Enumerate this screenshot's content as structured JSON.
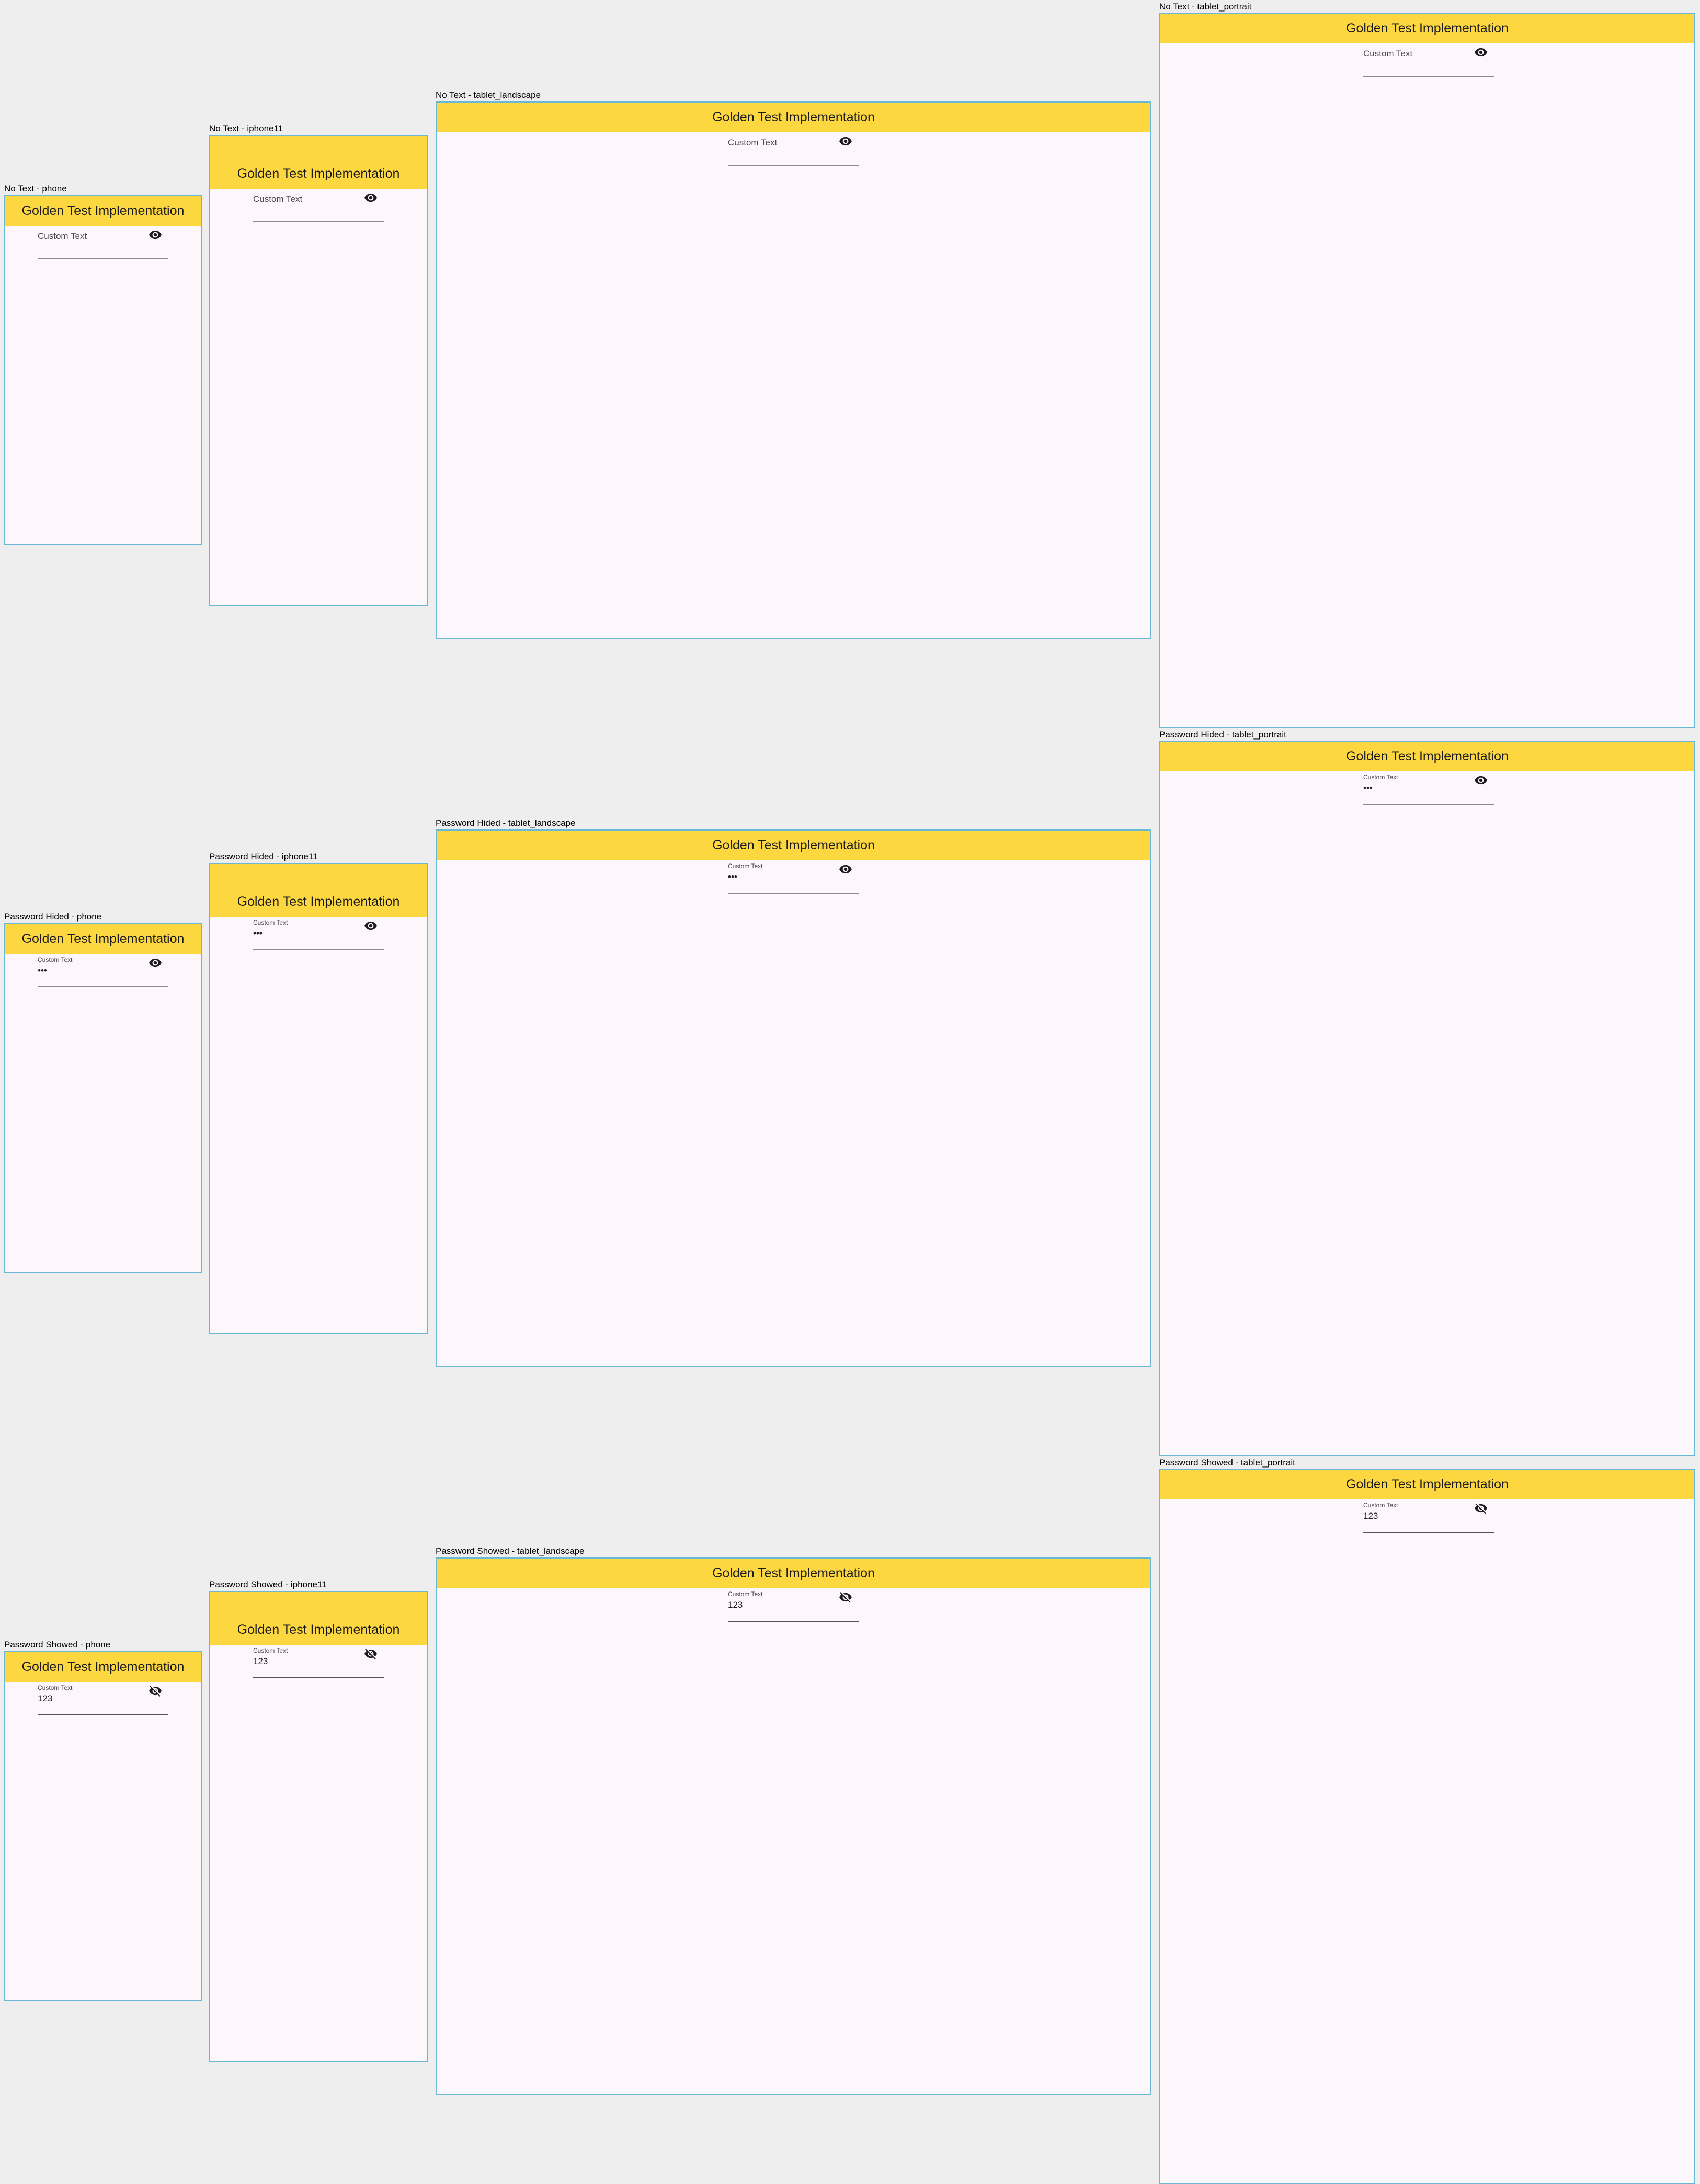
{
  "appbar_title": "Golden Test Implementation",
  "field_label": "Custom Text",
  "colors": {
    "background": "#eeeeee",
    "appbar": "#fdd73f",
    "surface": "#fdf7fc",
    "frame_border": "#6ab7d6",
    "underline": "#8f8a93"
  },
  "rows": [
    {
      "scenario": "No Text",
      "value": "",
      "password_visible": false,
      "icon": "eye-icon",
      "devices": [
        {
          "label": "No Text - phone"
        },
        {
          "label": "No Text - iphone11"
        },
        {
          "label": "No Text - tablet_landscape"
        },
        {
          "label": "No Text - tablet_portrait"
        }
      ]
    },
    {
      "scenario": "Password Hided",
      "value": "•••",
      "password_visible": false,
      "icon": "eye-icon",
      "devices": [
        {
          "label": "Password Hided - phone"
        },
        {
          "label": "Password Hided - iphone11"
        },
        {
          "label": "Password Hided - tablet_landscape"
        },
        {
          "label": "Password Hided - tablet_portrait"
        }
      ]
    },
    {
      "scenario": "Password Showed",
      "value": "123",
      "password_visible": true,
      "icon": "eye-off-icon",
      "devices": [
        {
          "label": "Password Showed - phone"
        },
        {
          "label": "Password Showed - iphone11"
        },
        {
          "label": "Password Showed - tablet_landscape"
        },
        {
          "label": "Password Showed - tablet_portrait"
        }
      ]
    }
  ]
}
